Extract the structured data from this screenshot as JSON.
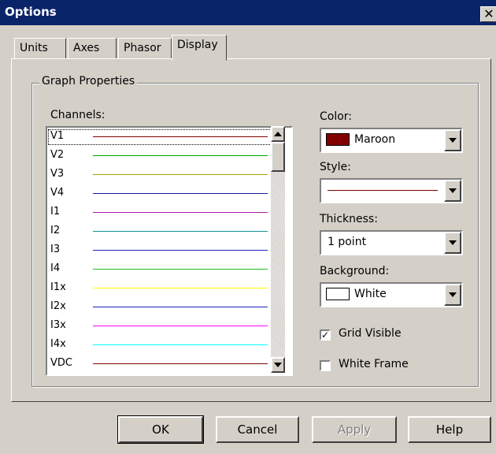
{
  "window": {
    "title": "Options",
    "close_glyph": "✕"
  },
  "tabs": [
    {
      "label": "Units",
      "active": false
    },
    {
      "label": "Axes",
      "active": false
    },
    {
      "label": "Phasor",
      "active": false
    },
    {
      "label": "Display",
      "active": true
    }
  ],
  "group": {
    "label": "Graph Properties"
  },
  "channels": {
    "label": "Channels:",
    "selected": "V1",
    "items": [
      {
        "name": "V1",
        "color": "#800000"
      },
      {
        "name": "V2",
        "color": "#00a000"
      },
      {
        "name": "V3",
        "color": "#a0a000"
      },
      {
        "name": "V4",
        "color": "#1020a0"
      },
      {
        "name": "I1",
        "color": "#a020a0"
      },
      {
        "name": "I2",
        "color": "#109090"
      },
      {
        "name": "I3",
        "color": "#2020c0"
      },
      {
        "name": "I4",
        "color": "#20c020"
      },
      {
        "name": "I1x",
        "color": "#ffff00"
      },
      {
        "name": "I2x",
        "color": "#2020c0"
      },
      {
        "name": "I3x",
        "color": "#ff00ff"
      },
      {
        "name": "I4x",
        "color": "#00ffff"
      },
      {
        "name": "VDC",
        "color": "#800000"
      }
    ]
  },
  "color": {
    "label": "Color:",
    "value": "Maroon",
    "swatch": "#800000"
  },
  "style": {
    "label": "Style:",
    "line_color": "#800000"
  },
  "thickness": {
    "label": "Thickness:",
    "value": "1 point"
  },
  "background": {
    "label": "Background:",
    "value": "White",
    "swatch": "#ffffff"
  },
  "grid_visible": {
    "label": "Grid Visible",
    "checked": true
  },
  "white_frame": {
    "label": "White Frame",
    "checked": false
  },
  "buttons": {
    "ok": "OK",
    "cancel": "Cancel",
    "apply": "Apply",
    "help": "Help"
  }
}
